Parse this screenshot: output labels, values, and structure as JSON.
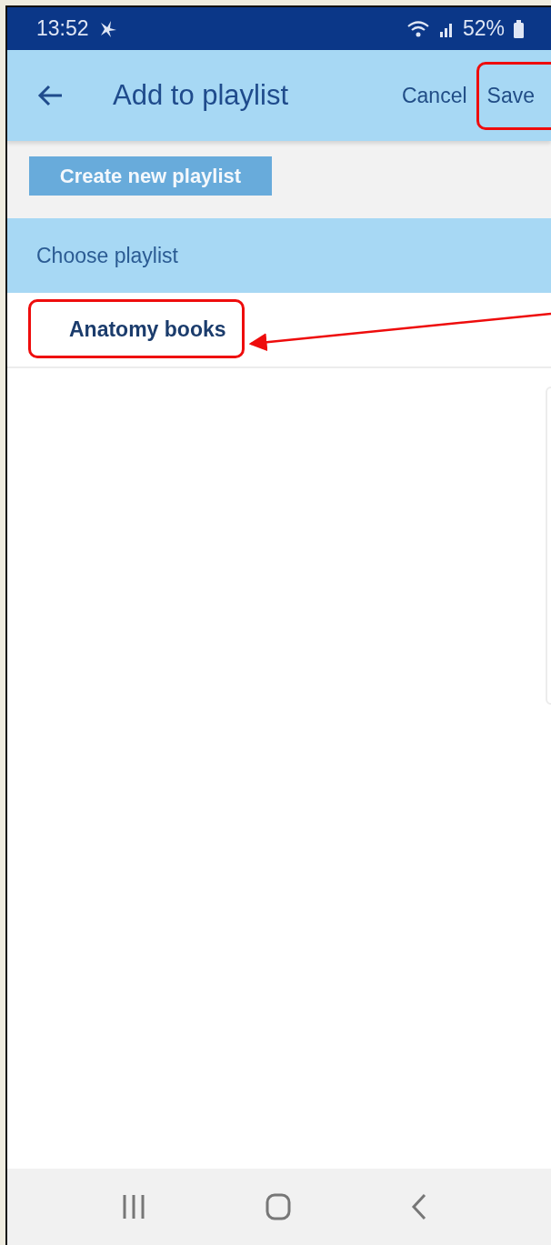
{
  "status_bar": {
    "time": "13:52",
    "battery": "52%"
  },
  "header": {
    "title": "Add to playlist",
    "actions": [
      {
        "label": "Cancel",
        "highlighted": false
      },
      {
        "label": "Save",
        "highlighted": true
      }
    ]
  },
  "create_button": "Create new playlist",
  "section_title": "Choose playlist",
  "playlists": [
    {
      "label": "Anatomy books",
      "highlighted": true
    }
  ]
}
